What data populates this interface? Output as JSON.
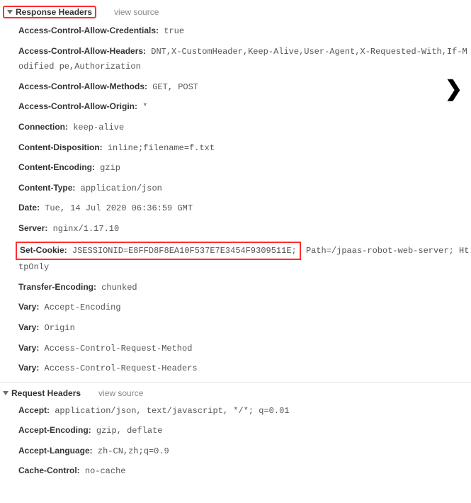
{
  "response": {
    "title": "Response Headers",
    "viewSource": "view source",
    "lines": [
      {
        "k": "Access-Control-Allow-Credentials:",
        "v": " true"
      },
      {
        "k": "Access-Control-Allow-Headers:",
        "v": " DNT,X-CustomHeader,Keep-Alive,User-Agent,X-Requested-With,If-Modified pe,Authorization"
      },
      {
        "k": "Access-Control-Allow-Methods:",
        "v": " GET, POST"
      },
      {
        "k": "Access-Control-Allow-Origin:",
        "v": " *"
      },
      {
        "k": "Connection:",
        "v": " keep-alive"
      },
      {
        "k": "Content-Disposition:",
        "v": " inline;filename=f.txt"
      },
      {
        "k": "Content-Encoding:",
        "v": " gzip"
      },
      {
        "k": "Content-Type:",
        "v": " application/json"
      },
      {
        "k": "Date:",
        "v": " Tue, 14 Jul 2020 06:36:59 GMT"
      },
      {
        "k": "Server:",
        "v": " nginx/1.17.10"
      },
      {
        "k": "Set-Cookie:",
        "v": " JSESSIONID=E8FFD8F8EA10F537E7E3454F9309511E;",
        "rest": " Path=/jpaas-robot-web-server; HttpOnly",
        "cookie": true
      },
      {
        "k": "Transfer-Encoding:",
        "v": " chunked"
      },
      {
        "k": "Vary:",
        "v": " Accept-Encoding"
      },
      {
        "k": "Vary:",
        "v": " Origin"
      },
      {
        "k": "Vary:",
        "v": " Access-Control-Request-Method"
      },
      {
        "k": "Vary:",
        "v": " Access-Control-Request-Headers"
      }
    ]
  },
  "request": {
    "title": "Request Headers",
    "viewSource": "view source",
    "lines": [
      {
        "k": "Accept:",
        "v": " application/json, text/javascript, */*; q=0.01"
      },
      {
        "k": "Accept-Encoding:",
        "v": " gzip, deflate"
      },
      {
        "k": "Accept-Language:",
        "v": " zh-CN,zh;q=0.9"
      },
      {
        "k": "Cache-Control:",
        "v": " no-cache"
      }
    ]
  },
  "chevron": "❯"
}
